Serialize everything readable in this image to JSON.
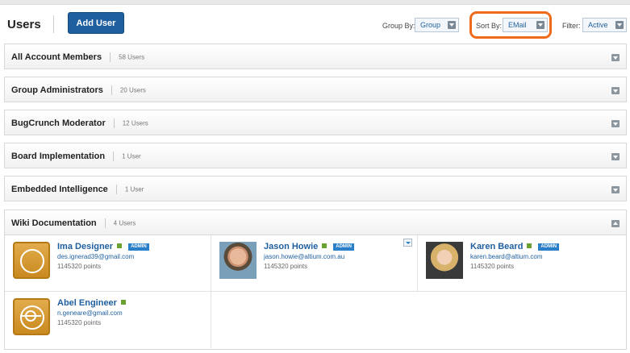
{
  "header": {
    "title": "Users",
    "add_user_label": "Add User",
    "group_by": {
      "label": "Group By:",
      "value": "Group"
    },
    "sort_by": {
      "label": "Sort By:",
      "value": "EMail"
    },
    "filter": {
      "label": "Filter:",
      "value": "Active"
    }
  },
  "groups": [
    {
      "name": "All Account Members",
      "count": "58 Users"
    },
    {
      "name": "Group Administrators",
      "count": "20 Users"
    },
    {
      "name": "BugCrunch Moderator",
      "count": "12 Users"
    },
    {
      "name": "Board Implementation",
      "count": "1 User"
    },
    {
      "name": "Embedded Intelligence",
      "count": "1 User"
    },
    {
      "name": "Wiki Documentation",
      "count": "4 Users"
    }
  ],
  "members": [
    {
      "name": "Ima Designer",
      "badge": "ADMIN",
      "email": "des.ignerad39@gmail.com",
      "points": "1145320 points"
    },
    {
      "name": "Jason Howie",
      "badge": "ADMIN",
      "email": "jason.howie@altium.com.au",
      "points": "1145320 points"
    },
    {
      "name": "Karen Beard",
      "badge": "ADMIN",
      "email": "karen.beard@altium.com",
      "points": "1145320 points"
    },
    {
      "name": "Abel Engineer",
      "badge": "",
      "email": "n.geneare@gmail.com",
      "points": "1145320 points"
    }
  ],
  "colors": {
    "accent": "#1f5f9f",
    "highlight": "#ef6a1a",
    "online": "#6aa232",
    "admin_badge": "#2a7fc9"
  }
}
